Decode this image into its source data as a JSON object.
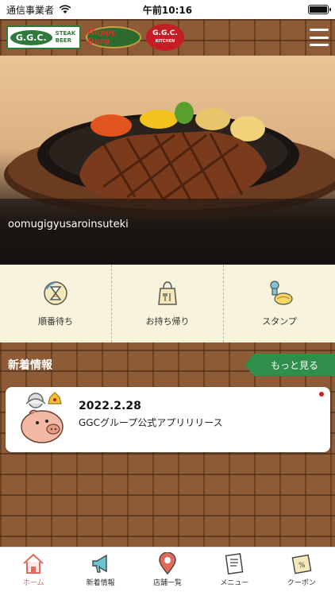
{
  "status_bar": {
    "carrier": "通信事業者",
    "time": "午前10:16"
  },
  "header": {
    "logo_ggc": "G.G.C.",
    "logo_ggc_sub1": "STEAK",
    "logo_ggc_sub2": "BEER",
    "logo_happy": "Happy Burg",
    "logo_kitchen": "G.G.C.",
    "logo_kitchen_sub": "KITCHEN"
  },
  "hero": {
    "caption": "oomugigyusaroinsuteki"
  },
  "quick_menu": [
    {
      "label": "順番待ち",
      "icon": "hourglass-icon"
    },
    {
      "label": "お持ち帰り",
      "icon": "takeout-bag-icon"
    },
    {
      "label": "スタンプ",
      "icon": "stamp-icon"
    }
  ],
  "news": {
    "title": "新着情報",
    "more_label": "もっと見る",
    "items": [
      {
        "date": "2022.2.28",
        "text": "GGCグループ公式アプリリリース"
      }
    ]
  },
  "tabbar": [
    {
      "label": "ホーム",
      "icon": "home-icon",
      "active": true
    },
    {
      "label": "新着情報",
      "icon": "megaphone-icon",
      "active": false
    },
    {
      "label": "店舗一覧",
      "icon": "map-pin-icon",
      "active": false
    },
    {
      "label": "メニュー",
      "icon": "menu-book-icon",
      "active": false
    },
    {
      "label": "クーポン",
      "icon": "coupon-icon",
      "active": false
    }
  ],
  "colors": {
    "accent_green": "#2f8f4a",
    "active_tab": "#e36a5a",
    "unread_dot": "#d21f1f"
  }
}
